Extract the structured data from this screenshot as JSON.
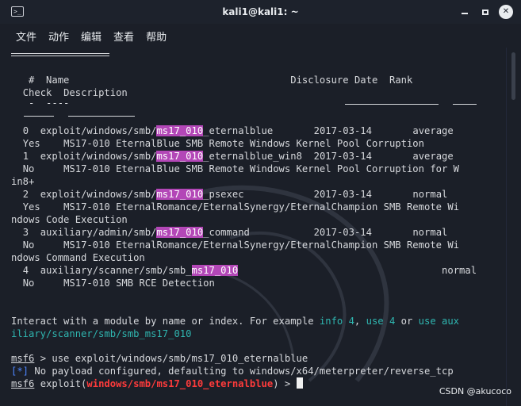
{
  "window": {
    "title": "kali1@kali1: ~",
    "icon": "terminal-icon",
    "controls": {
      "minimize": "minimize-icon",
      "maximize": "maximize-icon",
      "close_glyph": "✕"
    }
  },
  "menu": [
    "文件",
    "动作",
    "编辑",
    "查看",
    "帮助"
  ],
  "header": {
    "col_hash": "#",
    "col_name": "Name",
    "col_date": "Disclosure Date",
    "col_rank": "Rank",
    "col_check": "Check",
    "col_desc": "Description",
    "dash_small": "-",
    "dash_name": "----",
    "dash_check": "-----",
    "dash_desc": "-----------"
  },
  "modules": [
    {
      "num": "0",
      "pre": "exploit/windows/smb/",
      "hl": "ms17_010",
      "post": "_eternalblue",
      "date": "2017-03-14",
      "rank": "average",
      "check": "Yes",
      "desc": "MS17-010 EternalBlue SMB Remote Windows Kernel Pool Corruption",
      "desc_wrap": ""
    },
    {
      "num": "1",
      "pre": "exploit/windows/smb/",
      "hl": "ms17_010",
      "post": "_eternalblue_win8",
      "date": "2017-03-14",
      "rank": "average",
      "check": "No",
      "desc": "MS17-010 EternalBlue SMB Remote Windows Kernel Pool Corruption for W",
      "desc_wrap": "in8+"
    },
    {
      "num": "2",
      "pre": "exploit/windows/smb/",
      "hl": "ms17_010",
      "post": "_psexec",
      "date": "2017-03-14",
      "rank": "normal",
      "check": "Yes",
      "desc": "MS17-010 EternalRomance/EternalSynergy/EternalChampion SMB Remote Wi",
      "desc_wrap": "ndows Code Execution"
    },
    {
      "num": "3",
      "pre": "auxiliary/admin/smb/",
      "hl": "ms17_010",
      "post": "_command",
      "date": "2017-03-14",
      "rank": "normal",
      "check": "No",
      "desc": "MS17-010 EternalRomance/EternalSynergy/EternalChampion SMB Remote Wi",
      "desc_wrap": "ndows Command Execution"
    },
    {
      "num": "4",
      "pre": "auxiliary/scanner/smb/smb_",
      "hl": "ms17_010",
      "post": "",
      "date": "",
      "rank": "normal",
      "check": "No",
      "desc": "MS17-010 SMB RCE Detection",
      "desc_wrap": ""
    }
  ],
  "interact": {
    "text1": "Interact with a module by name or index. For example ",
    "info": "info 4",
    "sep": ", ",
    "use": "use 4",
    "or": " or ",
    "aux1": "use aux",
    "aux2": "iliary/scanner/smb/smb_ms17_010"
  },
  "session": {
    "prompt": "msf6",
    "cmd1": " > use exploit/windows/smb/ms17_010_eternalblue",
    "star": "[*]",
    "info_msg": " No payload configured, defaulting to windows/x64/meterpreter/reverse_tcp",
    "exploit_pre": " exploit(",
    "module": "windows/smb/ms17_010_eternalblue",
    "exploit_post": ") > "
  },
  "watermark": "CSDN @akucoco",
  "colors": {
    "bg": "#1b1f28",
    "text": "#d6d8dc",
    "highlight": "#b347b7",
    "teal": "#2fb6b0",
    "blue": "#4d86ff",
    "red": "#ff3b3b"
  }
}
